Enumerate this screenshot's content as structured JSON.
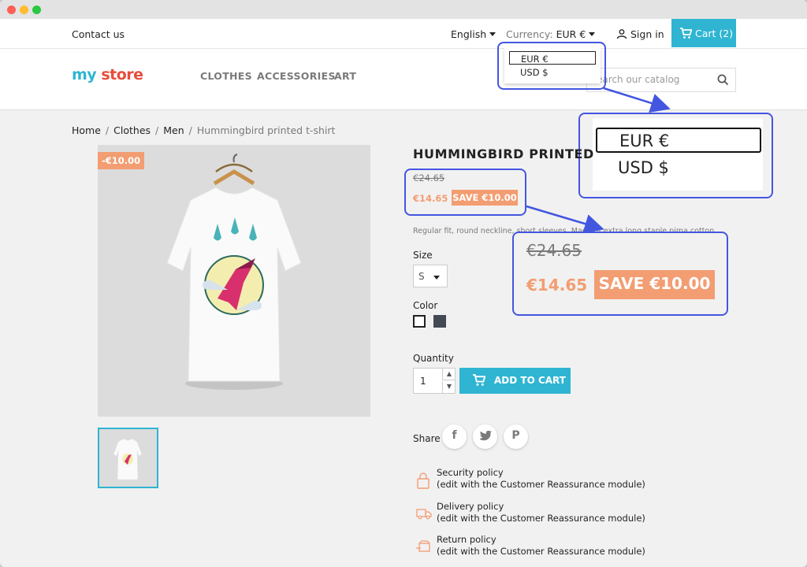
{
  "topbar": {
    "contact": "Contact us",
    "language": "English",
    "currency_label": "Currency:",
    "currency_value": "EUR €",
    "sign_in": "Sign in",
    "cart": "Cart (2)"
  },
  "header": {
    "logo_part1": "my",
    "logo_part2": "store",
    "nav": [
      "CLOTHES",
      "ACCESSORIES",
      "ART"
    ],
    "search_placeholder": "earch our catalog"
  },
  "currency_dropdown": {
    "options": [
      "EUR €",
      "USD $"
    ],
    "selected": "EUR €"
  },
  "breadcrumb": [
    "Home",
    "Clothes",
    "Men",
    "Hummingbird printed t-shirt"
  ],
  "product": {
    "discount_badge": "-€10.00",
    "title": "HUMMINGBIRD PRINTED",
    "old_price": "€24.65",
    "new_price": "€14.65",
    "save_label": "SAVE €10.00",
    "description": "Regular fit, round neckline, short sleeves. Made of extra long staple pima cotton.",
    "size_label": "Size",
    "size_value": "S",
    "color_label": "Color",
    "quantity_label": "Quantity",
    "quantity_value": "1",
    "add_to_cart": "ADD TO CART",
    "share_label": "Share",
    "share_icons": [
      "facebook-icon",
      "twitter-icon",
      "pinterest-icon"
    ]
  },
  "reassurance": [
    {
      "title": "Security policy",
      "sub": "(edit with the Customer Reassurance module)",
      "icon": "lock-icon"
    },
    {
      "title": "Delivery policy",
      "sub": "(edit with the Customer Reassurance module)",
      "icon": "truck-icon"
    },
    {
      "title": "Return policy",
      "sub": "(edit with the Customer Reassurance module)",
      "icon": "return-box-icon"
    }
  ],
  "colors": {
    "accent": "#2fb5d2",
    "sale": "#f39d72",
    "highlight": "#4356e0"
  }
}
